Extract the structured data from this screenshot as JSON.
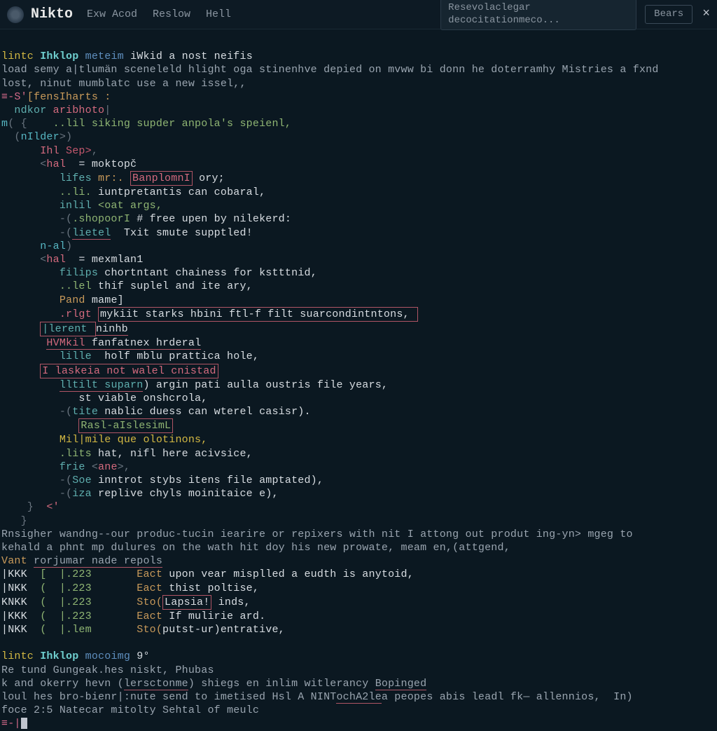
{
  "titlebar": {
    "app_name": "Nikto",
    "menu": [
      "Exw Acod",
      "Reslow",
      "Hell"
    ],
    "search_placeholder": "Resevolaclegar decocitationmeco...",
    "button": "Bears",
    "close": "×"
  },
  "term": {
    "l1_a": "lintc ",
    "l1_b": "Ihklop ",
    "l1_c": "meteim ",
    "l1_d": "iWkid a nost neifis",
    "l2": "load semy a|tlumän sceneleld hlight oga stinenhve depied on mvww bi donn he doterramhy Mistries a fxnd",
    "l3": "lost, ninut mumblatc use a new issel,,",
    "l4_a": "≡-S'",
    "l4_b": "[fensIharts :",
    "l5_a": "  ndkor ",
    "l5_b": "aribhoto",
    "l5_c": "|",
    "l6_a": "m",
    "l6_b": "( {",
    "l6_c": "    ..lil siking supder anpola's speienl,",
    "l7_a": "  (",
    "l7_b": "nIlder",
    "l7_c": ">)",
    "l8_a": "      Ihl ",
    "l8_b": "Sep>",
    "l8_c": ",",
    "l9_a": "      <",
    "l9_b": "hal",
    "l9_c": "  = moktopč",
    "l10_a": "         lifes ",
    "l10_b": "mr:. ",
    "l10_c": "BanplomnI",
    "l10_d": " ory;",
    "l11_a": "         ",
    "l11_b": "..li. ",
    "l11_c": "iuntpretantis can cobaral,",
    "l12_a": "         inlil ",
    "l12_b": "<oat args,",
    "l13_a": "         -(",
    "l13_b": ".shopoorI",
    "l13_c": " # free upen by nilekerd:",
    "l14_a": "         -(",
    "l14_b": "lietel",
    "l14_c": "  Txit smute supptled!",
    "l15_a": "      ",
    "l15_b": "n-al",
    "l15_c": ")",
    "l16_a": "      <",
    "l16_b": "hal",
    "l16_c": "  = mexmlan1",
    "l17_a": "         ",
    "l17_b": "filips ",
    "l17_c": "chortntant chainess for kstttnid,",
    "l18_a": "         ",
    "l18_b": "..lel ",
    "l18_c": "thif suplel and ite ary,",
    "l19_a": "         ",
    "l19_b": "Pand ",
    "l19_c": "mame]",
    "l20_a": "         ",
    "l20_b": ".rlgt ",
    "l20_c": "mykiit starks hbini ftl-f filt suarcondintntons, ",
    "l21_a": "      ",
    "l21_b": "|lerent ",
    "l21_c": "ninhb",
    "l22_a": "       ",
    "l22_b": "HVMkil ",
    "l22_c": "fanfatnex hrderal",
    "l23_a": "         lille  ",
    "l23_b": "holf mblu prattica hole,",
    "l24_a": "      ",
    "l24_b": "I laskeia not walel cnistad",
    "l25_a": "         ",
    "l25_b": "lltilt suparn",
    "l25_c": ") argin pati aulla oustris file years,",
    "l26_a": "            st viable onshcrola,",
    "l27_a": "         -(",
    "l27_b": "tite ",
    "l27_c": "nablic duess can wterel casisr).",
    "l28_a": "            ",
    "l28_b": "Rasl-aIslesimL",
    "l29_a": "         ",
    "l29_b": "Mil|mile que olotinons,",
    "l30_a": "         ",
    "l30_b": ".lits ",
    "l30_c": "hat, nifl here acivsice,",
    "l31_a": "         ",
    "l31_b": "frie ",
    "l31_c": "<",
    "l31_d": "ane",
    "l31_e": ">,",
    "l32_a": "         -(",
    "l32_b": "Soe ",
    "l32_c": "inntrot stybs itens file amptated),",
    "l33_a": "         -(",
    "l33_b": "iza ",
    "l33_c": "replive chyls moinitaice e),",
    "l34_a": "    }",
    "l34_b": "  <",
    "l34_c": "'",
    "l35": "   }",
    "l36": "Rnsigher wandng--our produc-tucin iearire or repixers with nit I attong out produt ing-yn> mgeg to",
    "l37": "kehald a phnt mp dulures on the wath hit doy his new prowate, meam en,(attgend,",
    "l38_a": "Vant ",
    "l38_b": "rorjumar nade repols",
    "tbl": [
      {
        "c1": "|KKK",
        "c2": "  [  |.223",
        "c3": "       Eact",
        "c4": " upon vear misplled a eudth is anytoid,"
      },
      {
        "c1": "|NKK",
        "c2": "  (  |.223",
        "c3": "       Eact",
        "c4": " thist poltise,"
      },
      {
        "c1": "KNKK",
        "c2": "  (  |.223",
        "c3": "       Sto(",
        "c4b": "Lapsia!",
        "c4c": " inds,"
      },
      {
        "c1": "|KKK",
        "c2": "  (  |.223",
        "c3": "       Eact",
        "c4": " If mulirie ard."
      },
      {
        "c1": "|NKK",
        "c2": "  (  |.lem",
        "c3": "       Sto(",
        "c4": "putst-ur)entrative,"
      }
    ],
    "l44_a": "lintc ",
    "l44_b": "Ihklop ",
    "l44_c": "mocoimg ",
    "l44_d": "9°",
    "l45": "Re tund Gungeak.hes niskt, Phubas",
    "l46_a": "k and okerry hevn (",
    "l46_b": "lersctonme",
    "l46_c": ") shiegs en inlim witlerancy ",
    "l46_d": "Bopinged",
    "l47_a": "loul hes bro-bienr|:nute send to imetised Hsl A NINT",
    "l47_b": "ochA2le",
    "l47_c": "a peopes abis leadl fk— allennios,  In)",
    "l48": "foce 2:5 Natecar mitolty Sehtal of meulc",
    "l49": "≡-|"
  }
}
